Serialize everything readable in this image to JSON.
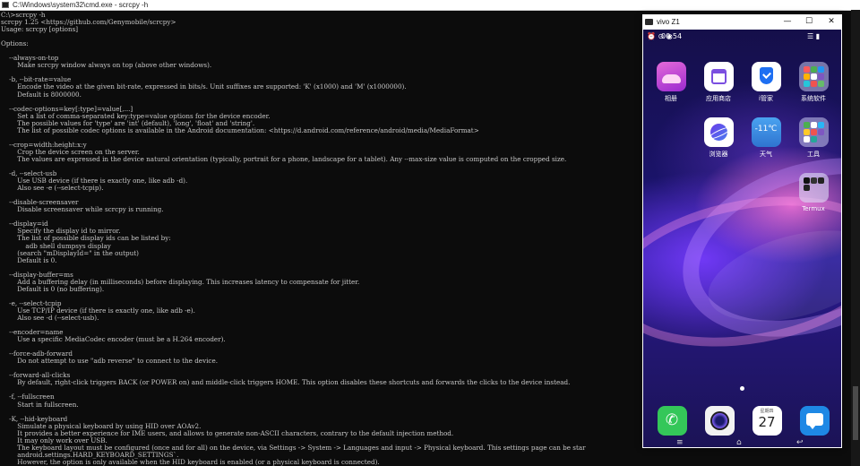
{
  "cmd": {
    "title": "C:\\Windows\\system32\\cmd.exe - scrcpy -h",
    "lines": [
      "C:\\>scrcpy -h",
      "scrcpy 1.25 <https://github.com/Genymobile/scrcpy>",
      "Usage: scrcpy [options]",
      "",
      "Options:",
      "",
      "    --always-on-top",
      "        Make scrcpy window always on top (above other windows).",
      "",
      "    -b, --bit-rate=value",
      "        Encode the video at the given bit-rate, expressed in bits/s. Unit suffixes are supported: 'K' (x1000) and 'M' (x1000000).",
      "        Default is 8000000.",
      "",
      "    --codec-options=key[:type]=value[,...]",
      "        Set a list of comma-separated key:type=value options for the device encoder.",
      "        The possible values for 'type' are 'int' (default), 'long', 'float' and 'string'.",
      "        The list of possible codec options is available in the Android documentation: <https://d.android.com/reference/android/media/MediaFormat>",
      "",
      "    --crop=width:height:x:y",
      "        Crop the device screen on the server.",
      "        The values are expressed in the device natural orientation (typically, portrait for a phone, landscape for a tablet). Any --max-size value is computed on the cropped size.",
      "",
      "    -d, --select-usb",
      "        Use USB device (if there is exactly one, like adb -d).",
      "        Also see -e (--select-tcpip).",
      "",
      "    --disable-screensaver",
      "        Disable screensaver while scrcpy is running.",
      "",
      "    --display=id",
      "        Specify the display id to mirror.",
      "        The list of possible display ids can be listed by:",
      "            adb shell dumpsys display",
      "        (search \"mDisplayId=\" in the output)",
      "        Default is 0.",
      "",
      "    --display-buffer=ms",
      "        Add a buffering delay (in milliseconds) before displaying. This increases latency to compensate for jitter.",
      "        Default is 0 (no buffering).",
      "",
      "    -e, --select-tcpip",
      "        Use TCP/IP device (if there is exactly one, like adb -e).",
      "        Also see -d (--select-usb).",
      "",
      "    --encoder=name",
      "        Use a specific MediaCodec encoder (must be a H.264 encoder).",
      "",
      "    --force-adb-forward",
      "        Do not attempt to use \"adb reverse\" to connect to the device.",
      "",
      "    --forward-all-clicks",
      "        By default, right-click triggers BACK (or POWER on) and middle-click triggers HOME. This option disables these shortcuts and forwards the clicks to the device instead.",
      "",
      "    -f, --fullscreen",
      "        Start in fullscreen.",
      "",
      "    -K, --hid-keyboard",
      "        Simulate a physical keyboard by using HID over AOAv2.",
      "        It provides a better experience for IME users, and allows to generate non-ASCII characters, contrary to the default injection method.",
      "        It may only work over USB.",
      "        The keyboard layout must be configured (once and for all) on the device, via Settings -> System -> Languages and input -> Physical keyboard. This settings page can be star",
      "        android.settings.HARD_KEYBOARD_SETTINGS`.",
      "        However, the option is only available when the HID keyboard is enabled (or a physical keyboard is connected)."
    ]
  },
  "phone_window": {
    "title": "vivo Z1",
    "minimize": "—",
    "maximize": "☐",
    "close": "✕"
  },
  "phone": {
    "status_time": "00:54",
    "status_icons_left": "⏰ ⊙ ◉",
    "status_icons_right": "☰ ▮",
    "apps": [
      {
        "label": "相册",
        "icon": "gallery-icon",
        "color": "#c04ad8"
      },
      {
        "label": "应用商店",
        "icon": "app-store-icon",
        "color": "#ffffff"
      },
      {
        "label": "i管家",
        "icon": "i-manager-shield-icon",
        "color": "#1e6ff2"
      },
      {
        "label": "系统软件",
        "icon": "system-apps-folder-icon",
        "color": "#8e8fd0"
      },
      {
        "label": "浏览器",
        "icon": "browser-icon",
        "color": "#ffffff"
      },
      {
        "label": "天气",
        "icon": "weather-icon",
        "color": "#3b8de0",
        "icon_text": "-11℃"
      },
      {
        "label": "工具",
        "icon": "tools-folder-icon",
        "color": "#9aa0e6"
      },
      {
        "label": "Termux",
        "icon": "termux-folder-icon",
        "color": "#b9b9e8"
      }
    ],
    "dock": [
      {
        "icon": "phone-icon",
        "color": "#34c759"
      },
      {
        "icon": "camera-icon",
        "color": "#f2f2f2"
      },
      {
        "icon": "calendar-icon",
        "color": "#ffffff",
        "day_label": "星期四",
        "day": "27"
      },
      {
        "icon": "messages-icon",
        "color": "#1e88e5"
      }
    ],
    "nav": {
      "menu": "≡",
      "home": "⌂",
      "back": "↩"
    }
  }
}
